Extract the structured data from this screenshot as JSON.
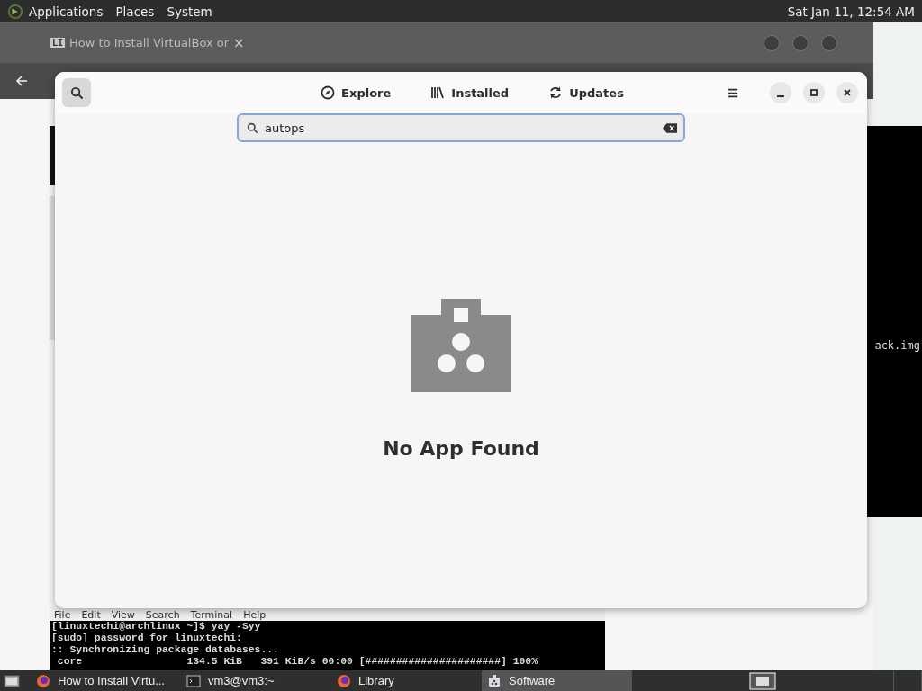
{
  "top_panel": {
    "menus": [
      "Applications",
      "Places",
      "System"
    ],
    "clock": "Sat Jan 11, 12:54 AM"
  },
  "browser": {
    "tab": {
      "favicon": "LI",
      "title": "How to Install VirtualBox or",
      "close": "×"
    }
  },
  "side_terminal": {
    "text": "ack.img"
  },
  "terminal": {
    "menus": [
      "File",
      "Edit",
      "View",
      "Search",
      "Terminal",
      "Help"
    ],
    "lines": [
      "[linuxtechi@archlinux ~]$ yay -Syy",
      "[sudo] password for linuxtechi:",
      ":: Synchronizing package databases...",
      " core                 134.5 KiB   391 KiB/s 00:00 [######################] 100%"
    ]
  },
  "software": {
    "search_toggle": {
      "selected": true
    },
    "tabs": [
      {
        "label": "Explore",
        "kind": "explore",
        "selected": false
      },
      {
        "label": "Installed",
        "kind": "installed",
        "selected": false
      },
      {
        "label": "Updates",
        "kind": "updates",
        "selected": false
      }
    ],
    "search": {
      "value": "autops"
    },
    "empty_state": {
      "title": "No App Found"
    }
  },
  "taskbar": {
    "tasks": [
      {
        "label": "How to Install Virtu...",
        "kind": "browser",
        "selected": false
      },
      {
        "label": "vm3@vm3:~",
        "kind": "terminal",
        "selected": false
      },
      {
        "label": "Library",
        "kind": "browser",
        "selected": false
      },
      {
        "label": "Software",
        "kind": "software",
        "selected": true
      }
    ]
  }
}
